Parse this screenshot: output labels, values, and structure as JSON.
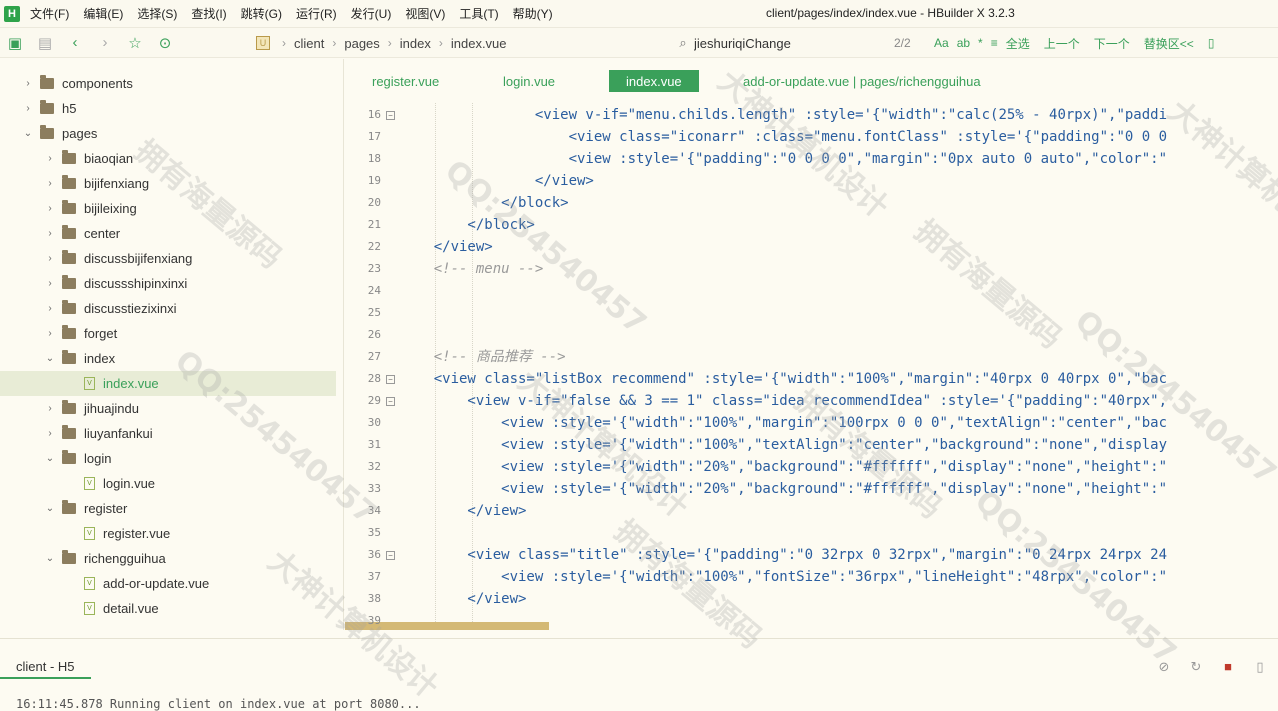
{
  "menubar": {
    "logo": "H",
    "items": [
      "文件(F)",
      "编辑(E)",
      "选择(S)",
      "查找(I)",
      "跳转(G)",
      "运行(R)",
      "发行(U)",
      "视图(V)",
      "工具(T)",
      "帮助(Y)"
    ],
    "title": "client/pages/index/index.vue - HBuilder X 3.2.3"
  },
  "toolbar": {
    "breadcrumbs": [
      "client",
      "pages",
      "index",
      "index.vue"
    ],
    "search": {
      "value": "jieshuriqiChange",
      "count": "2/2",
      "options": [
        "Aa",
        "ab",
        "*"
      ],
      "buttons": [
        "全选",
        "上一个",
        "下一个",
        "替换区<<"
      ]
    }
  },
  "sidebar": {
    "items": [
      {
        "label": "components",
        "type": "folder",
        "expanded": false,
        "depth": 0
      },
      {
        "label": "h5",
        "type": "folder",
        "expanded": false,
        "depth": 0
      },
      {
        "label": "pages",
        "type": "folder",
        "expanded": true,
        "depth": 0
      },
      {
        "label": "biaoqian",
        "type": "folder",
        "expanded": false,
        "depth": 1
      },
      {
        "label": "bijifenxiang",
        "type": "folder",
        "expanded": false,
        "depth": 1
      },
      {
        "label": "bijileixing",
        "type": "folder",
        "expanded": false,
        "depth": 1
      },
      {
        "label": "center",
        "type": "folder",
        "expanded": false,
        "depth": 1
      },
      {
        "label": "discussbijifenxiang",
        "type": "folder",
        "expanded": false,
        "depth": 1
      },
      {
        "label": "discussshipinxinxi",
        "type": "folder",
        "expanded": false,
        "depth": 1
      },
      {
        "label": "discusstiezixinxi",
        "type": "folder",
        "expanded": false,
        "depth": 1
      },
      {
        "label": "forget",
        "type": "folder",
        "expanded": false,
        "depth": 1
      },
      {
        "label": "index",
        "type": "folder",
        "expanded": true,
        "depth": 1
      },
      {
        "label": "index.vue",
        "type": "file",
        "depth": 2,
        "selected": true
      },
      {
        "label": "jihuajindu",
        "type": "folder",
        "expanded": false,
        "depth": 1
      },
      {
        "label": "liuyanfankui",
        "type": "folder",
        "expanded": false,
        "depth": 1
      },
      {
        "label": "login",
        "type": "folder",
        "expanded": true,
        "depth": 1
      },
      {
        "label": "login.vue",
        "type": "file",
        "depth": 2
      },
      {
        "label": "register",
        "type": "folder",
        "expanded": true,
        "depth": 1
      },
      {
        "label": "register.vue",
        "type": "file",
        "depth": 2
      },
      {
        "label": "richengguihua",
        "type": "folder",
        "expanded": true,
        "depth": 1
      },
      {
        "label": "add-or-update.vue",
        "type": "file",
        "depth": 2
      },
      {
        "label": "detail.vue",
        "type": "file",
        "depth": 2
      }
    ]
  },
  "tabs": [
    {
      "label": "register.vue",
      "active": false
    },
    {
      "label": "login.vue",
      "active": false
    },
    {
      "label": "index.vue",
      "active": true
    },
    {
      "label": "add-or-update.vue | pages/richengguihua",
      "active": false
    }
  ],
  "editor": {
    "lines": [
      {
        "n": "16",
        "fold": true,
        "text": "                <view v-if=\"menu.childs.length\" :style='{\"width\":\"calc(25% - 40rpx)\",\"paddi"
      },
      {
        "n": "17",
        "fold": false,
        "text": "                    <view class=\"iconarr\" :class=\"menu.fontClass\" :style='{\"padding\":\"0 0 0"
      },
      {
        "n": "18",
        "fold": false,
        "text": "                    <view :style='{\"padding\":\"0 0 0 0\",\"margin\":\"0px auto 0 auto\",\"color\":\""
      },
      {
        "n": "19",
        "fold": false,
        "text": "                </view>"
      },
      {
        "n": "20",
        "fold": false,
        "text": "            </block>"
      },
      {
        "n": "21",
        "fold": false,
        "text": "        </block>"
      },
      {
        "n": "22",
        "fold": false,
        "text": "    </view>"
      },
      {
        "n": "23",
        "fold": false,
        "text": "    <!-- menu -->"
      },
      {
        "n": "24",
        "fold": false,
        "text": ""
      },
      {
        "n": "25",
        "fold": false,
        "text": ""
      },
      {
        "n": "26",
        "fold": false,
        "text": ""
      },
      {
        "n": "27",
        "fold": false,
        "text": "    <!-- 商品推荐 -->"
      },
      {
        "n": "28",
        "fold": true,
        "text": "    <view class=\"listBox recommend\" :style='{\"width\":\"100%\",\"margin\":\"40rpx 0 40rpx 0\",\"bac"
      },
      {
        "n": "29",
        "fold": true,
        "text": "        <view v-if=\"false && 3 == 1\" class=\"idea recommendIdea\" :style='{\"padding\":\"40rpx\","
      },
      {
        "n": "30",
        "fold": false,
        "text": "            <view :style='{\"width\":\"100%\",\"margin\":\"100rpx 0 0 0\",\"textAlign\":\"center\",\"bac"
      },
      {
        "n": "31",
        "fold": false,
        "text": "            <view :style='{\"width\":\"100%\",\"textAlign\":\"center\",\"background\":\"none\",\"display"
      },
      {
        "n": "32",
        "fold": false,
        "text": "            <view :style='{\"width\":\"20%\",\"background\":\"#ffffff\",\"display\":\"none\",\"height\":\""
      },
      {
        "n": "33",
        "fold": false,
        "text": "            <view :style='{\"width\":\"20%\",\"background\":\"#ffffff\",\"display\":\"none\",\"height\":\""
      },
      {
        "n": "34",
        "fold": false,
        "text": "        </view>"
      },
      {
        "n": "35",
        "fold": false,
        "text": ""
      },
      {
        "n": "36",
        "fold": true,
        "text": "        <view class=\"title\" :style='{\"padding\":\"0 32rpx 0 32rpx\",\"margin\":\"0 24rpx 24rpx 24"
      },
      {
        "n": "37",
        "fold": false,
        "text": "            <view :style='{\"width\":\"100%\",\"fontSize\":\"36rpx\",\"lineHeight\":\"48rpx\",\"color\":\""
      },
      {
        "n": "38",
        "fold": false,
        "text": "        </view>"
      },
      {
        "n": "39",
        "fold": false,
        "text": ""
      }
    ]
  },
  "bottom": {
    "tab": "client - H5",
    "console": "16:11:45.878 Running client on index.vue at port 8080..."
  },
  "watermarks": [
    "拥有海量源码",
    "QQ:254540457",
    "大神计算机设计"
  ],
  "colors": {
    "accent": "#3aa05a",
    "code": "#2a5d9f",
    "comment": "#9a9a9a"
  }
}
